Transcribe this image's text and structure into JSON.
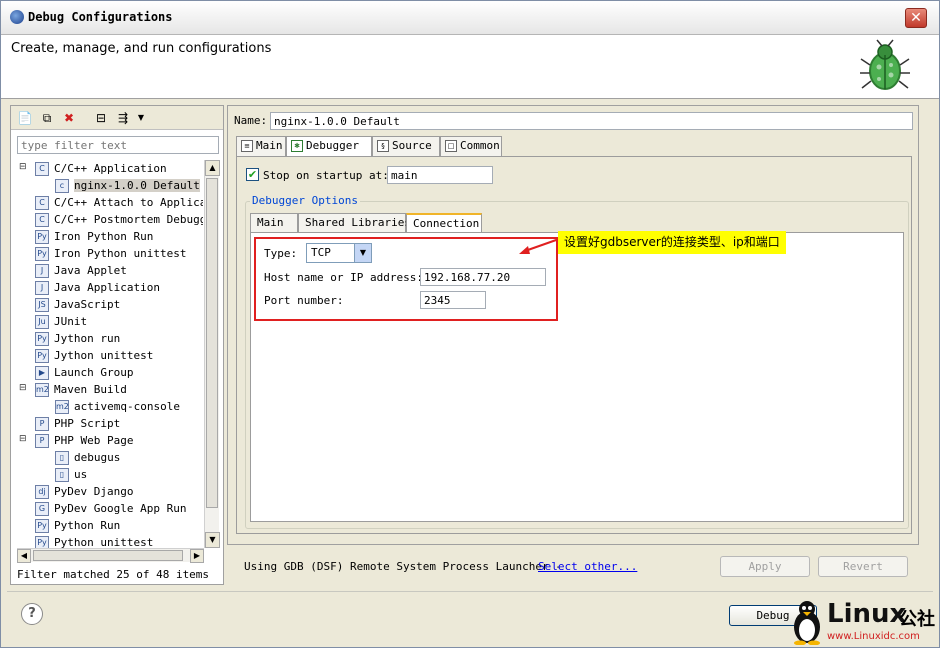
{
  "window": {
    "title": "Debug Configurations",
    "header_text": "Create, manage, and run configurations"
  },
  "left": {
    "filter_placeholder": "type filter text",
    "tree": [
      {
        "label": "C/C++ Application",
        "indent": 0,
        "expander": "⊟"
      },
      {
        "label": "nginx-1.0.0 Default",
        "indent": 1,
        "selected": true
      },
      {
        "label": "C/C++ Attach to Applicat",
        "indent": 0
      },
      {
        "label": "C/C++ Postmortem Debugge",
        "indent": 0
      },
      {
        "label": "Iron Python Run",
        "indent": 0
      },
      {
        "label": "Iron Python unittest",
        "indent": 0
      },
      {
        "label": "Java Applet",
        "indent": 0
      },
      {
        "label": "Java Application",
        "indent": 0
      },
      {
        "label": "JavaScript",
        "indent": 0
      },
      {
        "label": "JUnit",
        "indent": 0
      },
      {
        "label": "Jython run",
        "indent": 0
      },
      {
        "label": "Jython unittest",
        "indent": 0
      },
      {
        "label": "Launch Group",
        "indent": 0
      },
      {
        "label": "Maven Build",
        "indent": 0,
        "expander": "⊟"
      },
      {
        "label": "activemq-console",
        "indent": 1
      },
      {
        "label": "PHP Script",
        "indent": 0
      },
      {
        "label": "PHP Web Page",
        "indent": 0,
        "expander": "⊟"
      },
      {
        "label": "debugus",
        "indent": 1
      },
      {
        "label": "us",
        "indent": 1
      },
      {
        "label": "PyDev Django",
        "indent": 0
      },
      {
        "label": "PyDev Google App Run",
        "indent": 0
      },
      {
        "label": "Python Run",
        "indent": 0
      },
      {
        "label": "Python unittest",
        "indent": 0
      }
    ],
    "filter_status": "Filter matched 25 of 48 items"
  },
  "right": {
    "name_label": "Name:",
    "name_value": "nginx-1.0.0 Default",
    "tabs": [
      "Main",
      "Debugger",
      "Source",
      "Common"
    ],
    "stop_on_startup_label": "Stop on startup at:",
    "stop_on_startup_value": "main",
    "group_label": "Debugger Options",
    "subtabs": [
      "Main",
      "Shared Libraries",
      "Connection"
    ],
    "connection": {
      "type_label": "Type:",
      "type_value": "TCP",
      "host_label": "Host name or IP address:",
      "host_value": "192.168.77.20",
      "port_label": "Port number:",
      "port_value": "2345"
    },
    "annotation": "设置好gdbserver的连接类型、ip和端口",
    "launcher_text": "Using GDB (DSF) Remote System Process Launcher -",
    "launcher_link": "Select other...",
    "apply_label": "Apply",
    "revert_label": "Revert"
  },
  "footer": {
    "debug_label": "Debug",
    "watermark_text": "Linux",
    "watermark_cjk": "公社",
    "watermark_url": "www.Linuxidc.com"
  },
  "colors": {
    "annotation_bg": "#ffff00",
    "highlight_red": "#e02020",
    "link_blue": "#0000ee",
    "group_blue": "#0046d5"
  }
}
